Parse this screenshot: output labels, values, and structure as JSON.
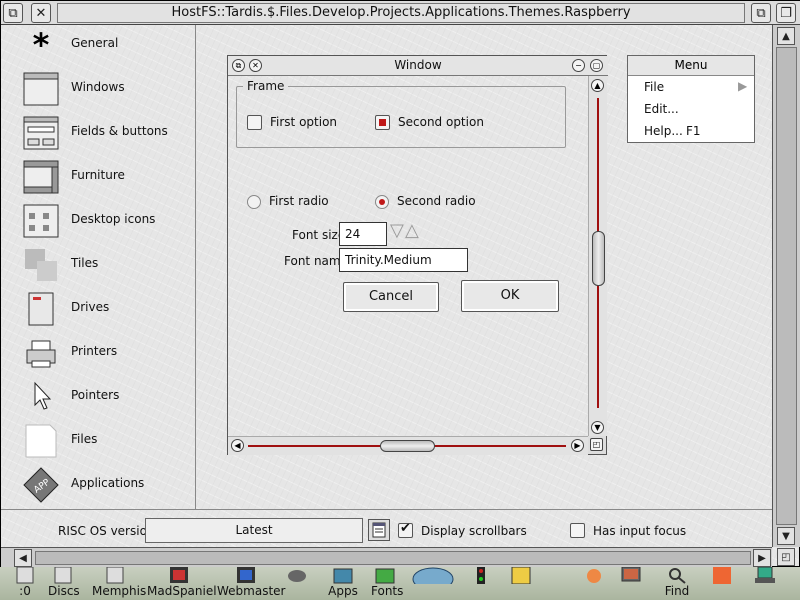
{
  "window": {
    "title": "HostFS::Tardis.$.Files.Develop.Projects.Applications.Themes.Raspberry"
  },
  "sidebar": {
    "items": [
      {
        "label": "General",
        "icon": "asterisk-icon"
      },
      {
        "label": "Windows",
        "icon": "window-icon"
      },
      {
        "label": "Fields & buttons",
        "icon": "fields-buttons-icon"
      },
      {
        "label": "Furniture",
        "icon": "furniture-icon"
      },
      {
        "label": "Desktop icons",
        "icon": "desktop-icons-icon"
      },
      {
        "label": "Tiles",
        "icon": "tiles-icon"
      },
      {
        "label": "Drives",
        "icon": "drive-icon"
      },
      {
        "label": "Printers",
        "icon": "printer-icon"
      },
      {
        "label": "Pointers",
        "icon": "pointer-icon"
      },
      {
        "label": "Files",
        "icon": "file-icon"
      },
      {
        "label": "Applications",
        "icon": "application-icon"
      }
    ]
  },
  "preview_window": {
    "title": "Window",
    "frame_label": "Frame",
    "option1": "First option",
    "option2": "Second option",
    "radio1": "First radio",
    "radio2": "Second radio",
    "font_size_label": "Font size",
    "font_size_value": "24",
    "font_name_label": "Font name",
    "font_name_value": "Trinity.Medium",
    "cancel": "Cancel",
    "ok": "OK"
  },
  "menu": {
    "title": "Menu",
    "items": [
      {
        "label": "File",
        "shortcut": ""
      },
      {
        "label": "Edit...",
        "shortcut": ""
      },
      {
        "label": "Help...",
        "shortcut": "F1"
      }
    ]
  },
  "bottom": {
    "risc_label": "RISC OS version",
    "risc_value": "Latest",
    "display_scrollbars": "Display scrollbars",
    "has_input_focus": "Has input focus"
  },
  "iconbar": {
    "items": [
      ":0",
      "Discs",
      "Memphis",
      "MadSpaniel",
      "Webmaster",
      "Apps",
      "Fonts",
      "Find"
    ]
  },
  "colors": {
    "accent": "#a01010",
    "chrome": "#dcdcdc",
    "texture": "#e6e6e6"
  }
}
